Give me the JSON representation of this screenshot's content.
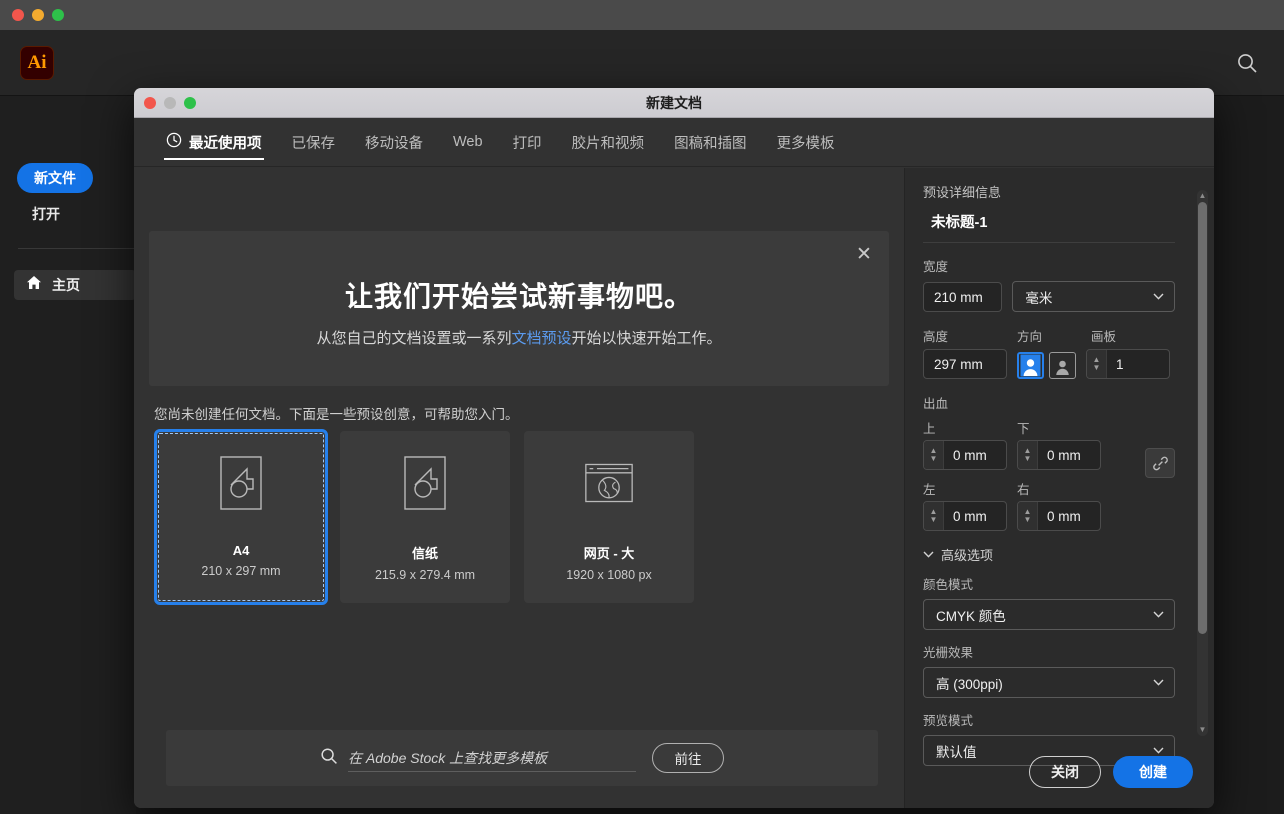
{
  "os_window": {
    "traffic_lights": [
      "close",
      "minimize",
      "maximize"
    ]
  },
  "app": {
    "logo_text": "Ai",
    "search_icon": "search-icon",
    "sidebar": {
      "new_file_label": "新文件",
      "open_label": "打开",
      "home_label": "主页",
      "home_icon": "home-icon"
    }
  },
  "dialog": {
    "title": "新建文档",
    "traffic_lights": [
      "close",
      "minimize",
      "maximize"
    ],
    "tabs": [
      {
        "label": "最近使用项",
        "icon": "clock-icon",
        "active": true
      },
      {
        "label": "已保存",
        "icon": "",
        "active": false
      },
      {
        "label": "移动设备",
        "icon": "",
        "active": false
      },
      {
        "label": "Web",
        "icon": "",
        "active": false
      },
      {
        "label": "打印",
        "icon": "",
        "active": false
      },
      {
        "label": "胶片和视频",
        "icon": "",
        "active": false
      },
      {
        "label": "图稿和插图",
        "icon": "",
        "active": false
      },
      {
        "label": "更多模板",
        "icon": "",
        "active": false
      }
    ],
    "banner": {
      "title": "让我们开始尝试新事物吧。",
      "subtitle_before": "从您自己的文档设置或一系列",
      "subtitle_link": "文档预设",
      "subtitle_after": "开始以快速开始工作。",
      "close_icon": "close-icon"
    },
    "presets_note": "您尚未创建任何文档。下面是一些预设创意，可帮助您入门。",
    "presets": [
      {
        "name": "A4",
        "dims": "210 x 297 mm",
        "icon": "document-page-icon",
        "selected": true
      },
      {
        "name": "信纸",
        "dims": "215.9 x 279.4 mm",
        "icon": "document-page-icon",
        "selected": false
      },
      {
        "name": "网页 - 大",
        "dims": "1920 x 1080 px",
        "icon": "web-browser-globe-icon",
        "selected": false
      }
    ],
    "stock": {
      "search_icon": "search-icon",
      "placeholder": "在 Adobe Stock 上查找更多模板",
      "value": "",
      "goto_label": "前往"
    },
    "details": {
      "heading": "预设详细信息",
      "doc_name": "未标题-1",
      "width_label": "宽度",
      "width_value": "210 mm",
      "unit_value": "毫米",
      "height_label": "高度",
      "height_value": "297 mm",
      "orientation_label": "方向",
      "orientation_portrait_icon": "orientation-portrait-icon",
      "orientation_landscape_icon": "orientation-landscape-icon",
      "artboards_label": "画板",
      "artboards_value": "1",
      "bleed_label": "出血",
      "bleed_top_label": "上",
      "bleed_top_value": "0 mm",
      "bleed_bottom_label": "下",
      "bleed_bottom_value": "0 mm",
      "bleed_left_label": "左",
      "bleed_left_value": "0 mm",
      "bleed_right_label": "右",
      "bleed_right_value": "0 mm",
      "bleed_link_icon": "link-chain-icon",
      "advanced_label": "高级选项",
      "color_mode_label": "颜色模式",
      "color_mode_value": "CMYK 颜色",
      "raster_label": "光栅效果",
      "raster_value": "高 (300ppi)",
      "preview_label": "预览模式",
      "preview_value": "默认值"
    },
    "footer": {
      "close_label": "关闭",
      "create_label": "创建"
    }
  },
  "colors": {
    "accent_blue": "#1473e6",
    "selection_blue": "#2680eb",
    "link_blue": "#5b9bef",
    "dialog_bg": "#323232",
    "panel_bg": "#2b2b2b",
    "card_bg": "#3b3b3b"
  }
}
